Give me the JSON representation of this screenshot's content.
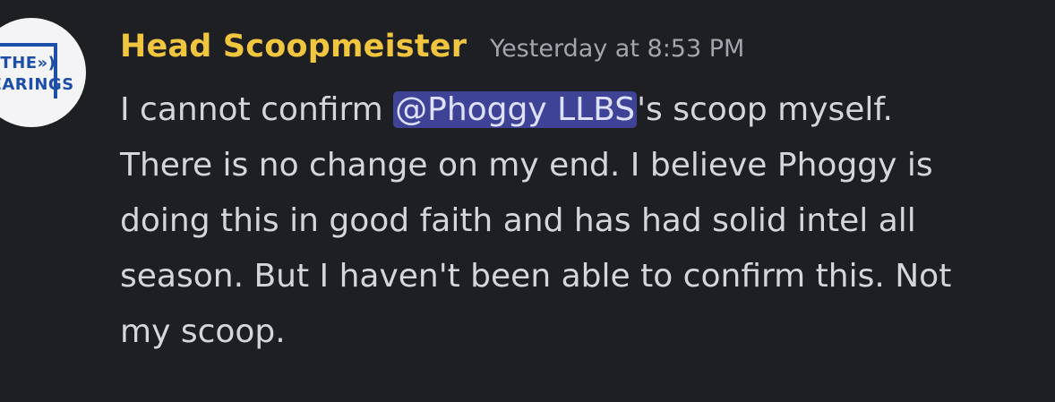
{
  "message": {
    "author": "Head Scoopmeister",
    "timestamp": "Yesterday at 8:53 PM",
    "avatar": {
      "line1": "«(THE»)",
      "line2": "HEARINGS"
    },
    "content": {
      "line1_prefix": "I cannot confirm ",
      "mention": "@Phoggy LLBS",
      "line1_suffix": "'s scoop myself.",
      "line2": "There is no change on my end. I believe Phoggy is",
      "line3": "doing this in good faith and has had solid intel all",
      "line4": "season. But I haven't been able to confirm this. Not",
      "line5": "my scoop."
    }
  },
  "colors": {
    "background": "#1e1f22",
    "username": "#f0c53f",
    "mention_bg": "#3e4396",
    "text": "#d4d6db"
  }
}
